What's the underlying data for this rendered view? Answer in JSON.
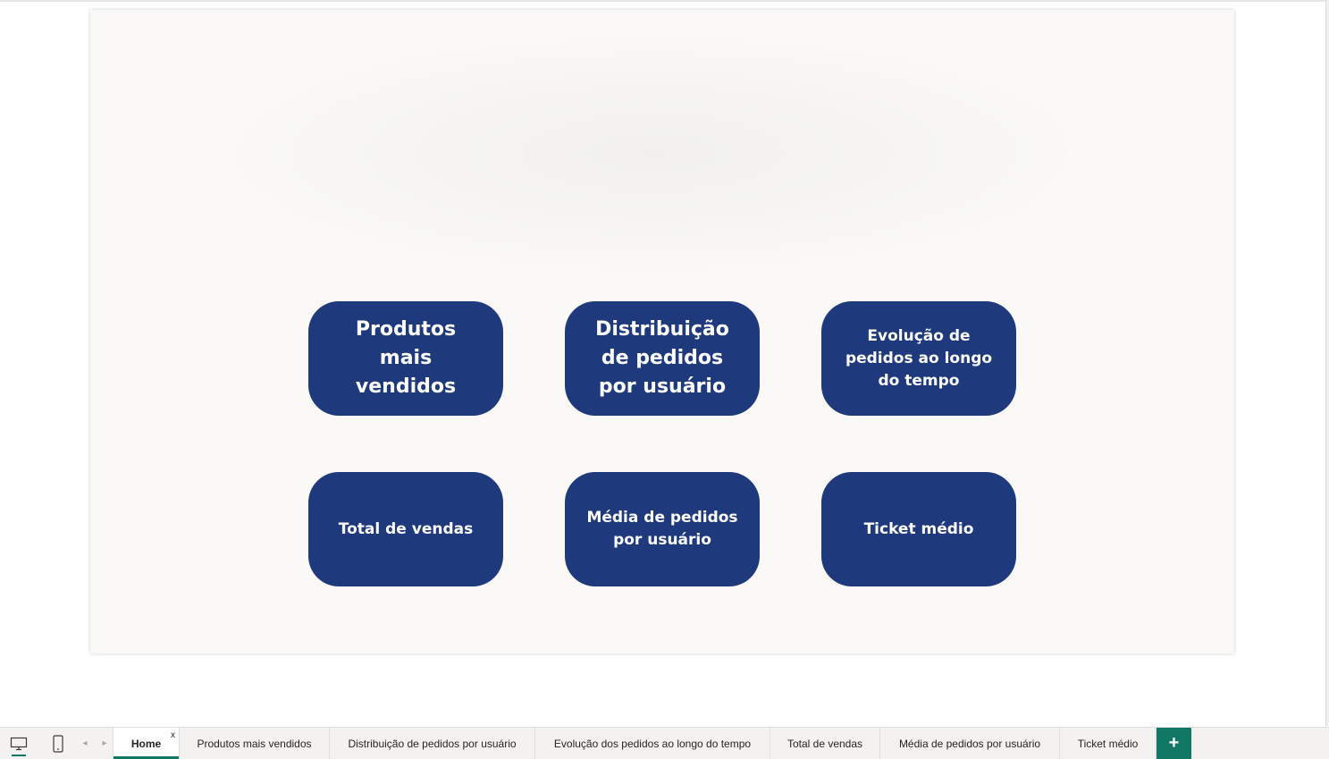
{
  "buttons": [
    {
      "lines": [
        "Produtos",
        "mais",
        "vendidos"
      ]
    },
    {
      "lines": [
        "Distribuição",
        "de pedidos",
        "por usuário"
      ]
    },
    {
      "lines": [
        "Evolução de",
        "pedidos ao longo",
        "do tempo"
      ]
    },
    {
      "lines": [
        "Total de vendas"
      ]
    },
    {
      "lines": [
        "Média de pedidos",
        "por usuário"
      ]
    },
    {
      "lines": [
        "Ticket médio"
      ]
    }
  ],
  "tabs": [
    {
      "label": "Home",
      "close": "x"
    },
    {
      "label": "Produtos mais vendidos"
    },
    {
      "label": "Distribuição de pedidos por usuário"
    },
    {
      "label": "Evolução dos pedidos ao longo do tempo"
    },
    {
      "label": "Total de vendas"
    },
    {
      "label": "Média de pedidos por usuário"
    },
    {
      "label": "Ticket médio"
    }
  ],
  "add_tab_label": "+",
  "arrows": {
    "left": "◂",
    "right": "▸"
  },
  "icons": {
    "desktop": "desktop-view-icon",
    "phone": "phone-view-icon"
  },
  "colors": {
    "button_bg": "#1f3a7c",
    "accent": "#117865",
    "canvas_bg": "#faf9f7"
  }
}
